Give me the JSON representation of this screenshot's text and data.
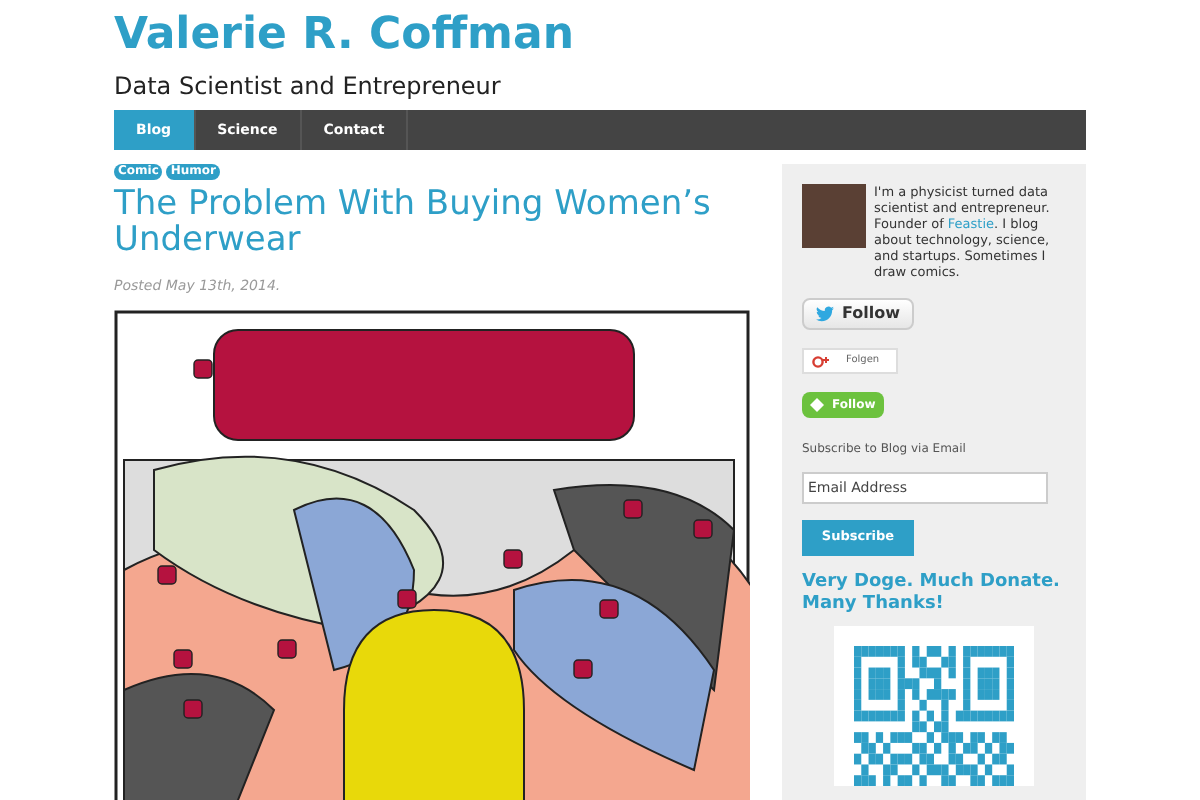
{
  "site": {
    "title": "Valerie R. Coffman",
    "tagline": "Data Scientist and Entrepreneur"
  },
  "nav": [
    {
      "label": "Blog",
      "selected": true
    },
    {
      "label": "Science",
      "selected": false
    },
    {
      "label": "Contact",
      "selected": false
    }
  ],
  "post": {
    "tags": [
      "Comic",
      "Humor"
    ],
    "title": "The Problem With Buying Women’s Underwear",
    "posted": "Posted May 13th, 2014."
  },
  "sidebar": {
    "bio": {
      "before": "I'm a physicist turned data scientist and entrepreneur. Founder of ",
      "link": "Feastie",
      "after": ". I blog about technology, science, and startups. Sometimes I draw comics."
    },
    "follow_buttons": [
      {
        "kind": "twitter",
        "label": "Follow"
      },
      {
        "kind": "gplus",
        "label": "Folgen"
      },
      {
        "kind": "feedly",
        "label": "Follow"
      }
    ],
    "subscribe": {
      "label": "Subscribe to Blog via Email",
      "placeholder": "Email Address",
      "button": "Subscribe"
    },
    "donate_heading": "Very Doge. Much Donate. Many Thanks!"
  }
}
